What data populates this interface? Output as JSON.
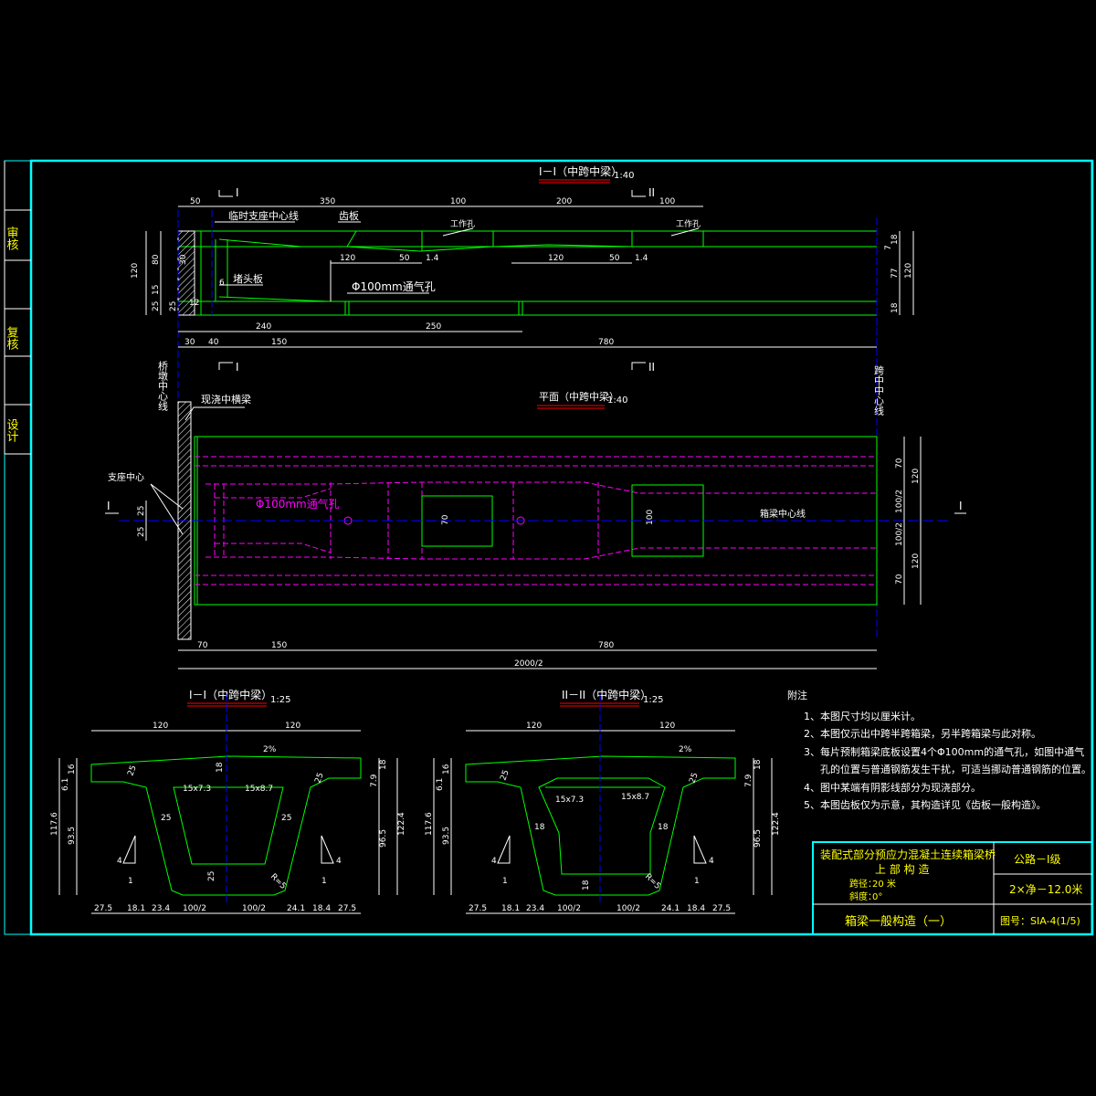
{
  "colors": {
    "frame": "#00ffff",
    "outline": "#00ff00",
    "hidden": "#ff00ff",
    "dim": "#ffffff",
    "center": "#0000ff",
    "title": "#ffff00",
    "underline": "#ff0000"
  },
  "signature_block": {
    "review": "审核",
    "recheck": "复核",
    "design": "设计"
  },
  "elevation": {
    "title": "I－I（中跨中梁）",
    "scale": "1:40",
    "section_mark": "I",
    "section_mark2": "II",
    "top_dims": [
      "50",
      "350",
      "100",
      "200",
      "100"
    ],
    "labels": {
      "support_line": "临时支座中心线",
      "dentation": "齿板",
      "work_hole1": "工作孔",
      "work_hole2": "工作孔",
      "end_plate": "堵头板",
      "vent": "Φ100mm通气孔"
    },
    "inner_dims": [
      "120",
      "50",
      "1.4",
      "120",
      "50",
      "1.4"
    ],
    "left_dims": [
      "120",
      "80",
      "30",
      "25",
      "15",
      "25",
      "12",
      "6",
      "12"
    ],
    "right_dims": [
      "18",
      "7",
      "77",
      "120",
      "18"
    ],
    "bottom_dims": [
      "240",
      "250"
    ],
    "bottom_dims2": [
      "30",
      "40",
      "150",
      "780"
    ]
  },
  "plan": {
    "title": "平面（中跨中梁）",
    "scale": "1:40",
    "labels": {
      "pier_center": "桥墩中心线",
      "cast_beam": "现浇中横梁",
      "bearing_center": "支座中心",
      "vent": "Φ100mm通气孔",
      "beam_center": "箱梁中心线",
      "span_center": "跨中中心线",
      "section_I": "I"
    },
    "hole_dims": [
      "70",
      "100"
    ],
    "left_dims": [
      "25",
      "25"
    ],
    "right_dims": [
      "70",
      "120",
      "100/2",
      "100/2",
      "120",
      "70"
    ],
    "bottom_dims": [
      "70",
      "150",
      "780"
    ],
    "total_dim": "2000/2"
  },
  "section1": {
    "title": "I－I（中跨中梁）",
    "scale": "1:25",
    "top_dims": [
      "120",
      "120"
    ],
    "slope": "2%",
    "labels": [
      "18",
      "25",
      "15x7.3",
      "15x8.7",
      "25",
      "25",
      "25",
      "25",
      "R=5"
    ],
    "left_dims": [
      "16",
      "6.1",
      "117.6",
      "93.5"
    ],
    "right_dims": [
      "18",
      "7.9",
      "96.5",
      "122.4"
    ],
    "slope_mark": [
      "4",
      "1",
      "4",
      "1"
    ],
    "bottom_dims": [
      "27.5",
      "18.1",
      "23.4",
      "100/2",
      "100/2",
      "24.1",
      "18.4",
      "27.5"
    ]
  },
  "section2": {
    "title": "II－II（中跨中梁）",
    "scale": "1:25",
    "top_dims": [
      "120",
      "120"
    ],
    "slope": "2%",
    "labels": [
      "25",
      "15x7.3",
      "15x8.7",
      "25",
      "18",
      "18",
      "18",
      "R=5"
    ],
    "left_dims": [
      "16",
      "6.1",
      "117.6",
      "93.5"
    ],
    "right_dims": [
      "18",
      "7.9",
      "96.5",
      "122.4"
    ],
    "slope_mark": [
      "4",
      "1",
      "4",
      "1"
    ],
    "bottom_dims": [
      "27.5",
      "18.1",
      "23.4",
      "100/2",
      "100/2",
      "24.1",
      "18.4",
      "27.5"
    ]
  },
  "notes": {
    "title": "附注",
    "items": [
      "1、本图尺寸均以厘米计。",
      "2、本图仅示出中跨半跨箱梁，另半跨箱梁与此对称。",
      "3、每片预制箱梁底板设置4个Φ100mm的通气孔，如图中通气",
      "孔的位置与普通钢筋发生干扰，可适当挪动普通钢筋的位置。",
      "4、图中某端有阴影线部分为现浇部分。",
      "5、本图齿板仅为示意，其构造详见《齿板一般构造》。"
    ]
  },
  "title_block": {
    "project": "装配式部分预应力混凝土连续箱梁桥",
    "subtitle": "上 部 构 造",
    "span_label": "跨径：",
    "span": "20 米",
    "skew_label": "斜度：",
    "skew": "0°",
    "grade": "公路－I级",
    "width": "2×净－12.0米",
    "drawing_name": "箱梁一般构造（一）",
    "drawing_no": "图号：SIA-4(1/5)"
  }
}
